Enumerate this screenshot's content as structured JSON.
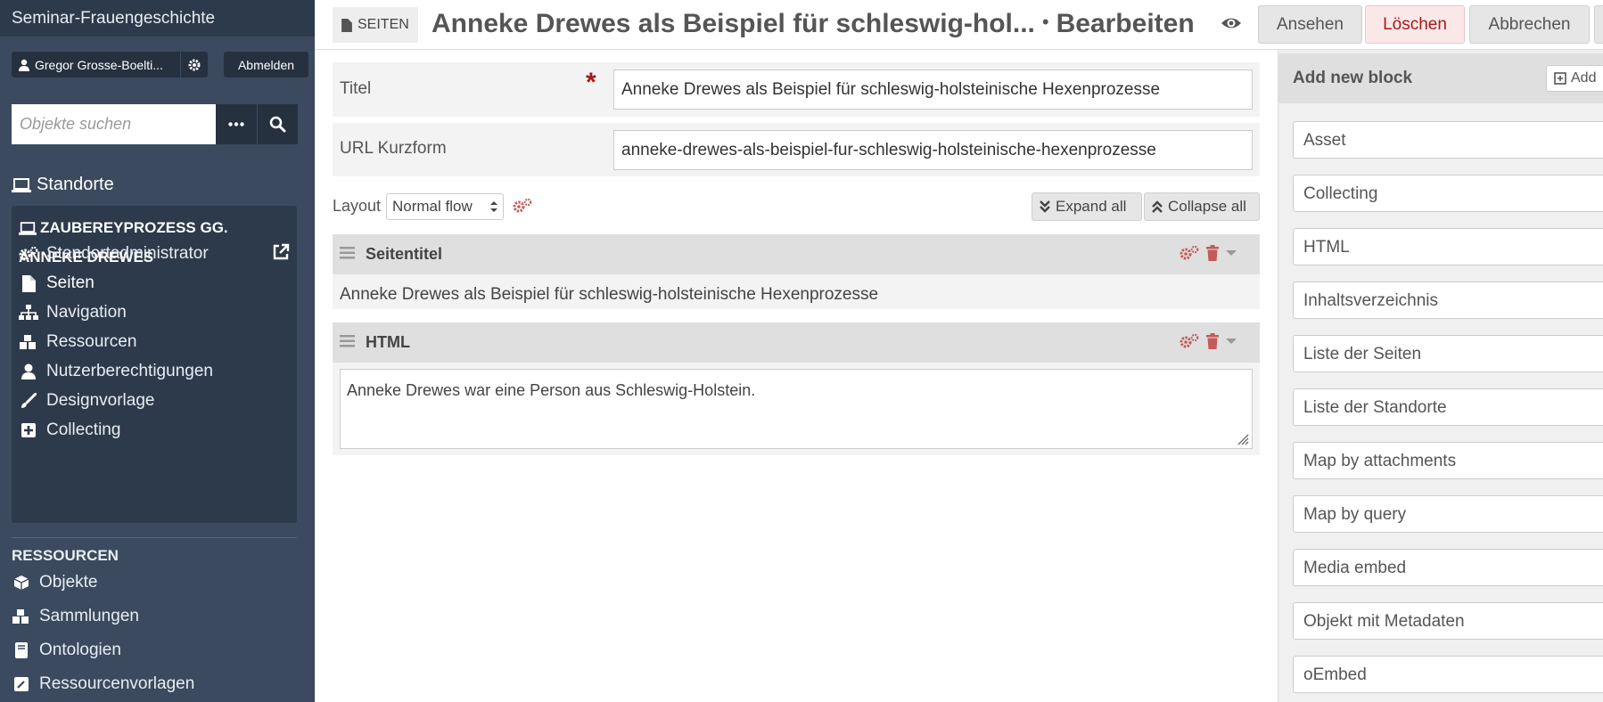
{
  "sidebar": {
    "site_title": "Seminar-Frauengeschichte",
    "user_name": "Gregor Grosse-Boelti...",
    "logout_label": "Abmelden",
    "search_placeholder": "Objekte suchen",
    "sites_heading": "Standorte",
    "site_name": "Zaubereyprozess gg. Anneke Drewes",
    "site_nav": [
      {
        "label": "Standortadministrator",
        "icon": "cogs-icon"
      },
      {
        "label": "Seiten",
        "icon": "page-icon"
      },
      {
        "label": "Navigation",
        "icon": "sitemap-icon"
      },
      {
        "label": "Ressourcen",
        "icon": "cubes-icon"
      },
      {
        "label": "Nutzerberechtigungen",
        "icon": "user-icon"
      },
      {
        "label": "Designvorlage",
        "icon": "brush-icon"
      },
      {
        "label": "Collecting",
        "icon": "plus-square-icon"
      }
    ],
    "resources_heading": "Ressourcen",
    "resource_nav": [
      {
        "label": "Objekte",
        "icon": "cube-icon"
      },
      {
        "label": "Sammlungen",
        "icon": "cubes-icon"
      },
      {
        "label": "Ontologien",
        "icon": "book-icon"
      },
      {
        "label": "Ressourcenvorlagen",
        "icon": "template-icon"
      }
    ]
  },
  "header": {
    "section_tag": "Seiten",
    "page_title": "Anneke Drewes als Beispiel für schleswig-hol...",
    "separator": "•",
    "mode": "Bearbeiten",
    "view_label": "Ansehen",
    "delete_label": "Löschen",
    "cancel_label": "Abbrechen"
  },
  "form": {
    "title_label": "Titel",
    "title_value": "Anneke Drewes als Beispiel für schleswig-holsteinische Hexenprozesse",
    "slug_label": "URL Kurzform",
    "slug_value": "anneke-drewes-als-beispiel-fur-schleswig-holsteinische-hexenprozesse",
    "layout_label": "Layout",
    "layout_value": "Normal flow",
    "expand_all": "Expand all",
    "collapse_all": "Collapse all"
  },
  "blocks": [
    {
      "title": "Seitentitel",
      "content": "Anneke Drewes als Beispiel für schleswig-holsteinische Hexenprozesse"
    },
    {
      "title": "HTML",
      "content": "Anneke Drewes war eine Person aus Schleswig-Holstein."
    }
  ],
  "right_panel": {
    "title": "Add new block",
    "add_label": "Add",
    "items": [
      "Asset",
      "Collecting",
      "HTML",
      "Inhaltsverzeichnis",
      "Liste der Seiten",
      "Liste der Standorte",
      "Map by attachments",
      "Map by query",
      "Media embed",
      "Objekt mit Metadaten",
      "oEmbed"
    ]
  },
  "colors": {
    "sidebar_bg": "#3b4a5e",
    "sidebar_dark": "#2d3a4b",
    "delete_red": "#a91919",
    "action_icon_red": "#c45a5a"
  }
}
